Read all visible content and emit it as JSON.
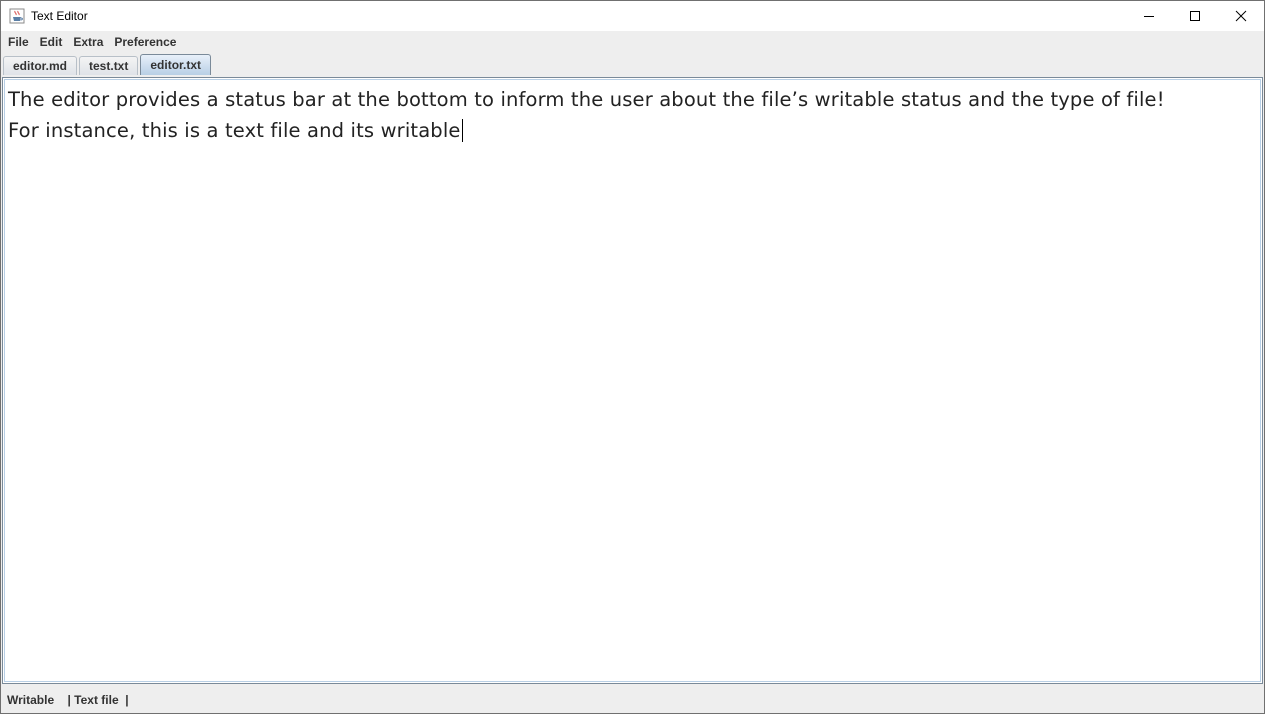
{
  "window": {
    "title": "Text Editor",
    "app_icon": "java-cup-icon",
    "controls": {
      "minimize_icon": "minimize-icon",
      "maximize_icon": "maximize-icon",
      "close_icon": "close-icon"
    }
  },
  "menubar": {
    "items": [
      {
        "label": "File"
      },
      {
        "label": "Edit"
      },
      {
        "label": "Extra"
      },
      {
        "label": "Preference"
      }
    ]
  },
  "tabs": [
    {
      "label": "editor.md",
      "active": false
    },
    {
      "label": "test.txt",
      "active": false
    },
    {
      "label": "editor.txt",
      "active": true
    }
  ],
  "editor": {
    "lines": [
      "The editor provides a status bar at the bottom to inform the user about the file’s writable status and the type of file!",
      "For instance, this is a text file and its writable"
    ]
  },
  "statusbar": {
    "writable": "Writable",
    "sep1": "    |",
    "file_type": " Text file",
    "sep2": "  |"
  },
  "colors": {
    "active_tab": "#b8cfe5",
    "editor_border": "#7a8a99",
    "background": "#eeeeee"
  }
}
